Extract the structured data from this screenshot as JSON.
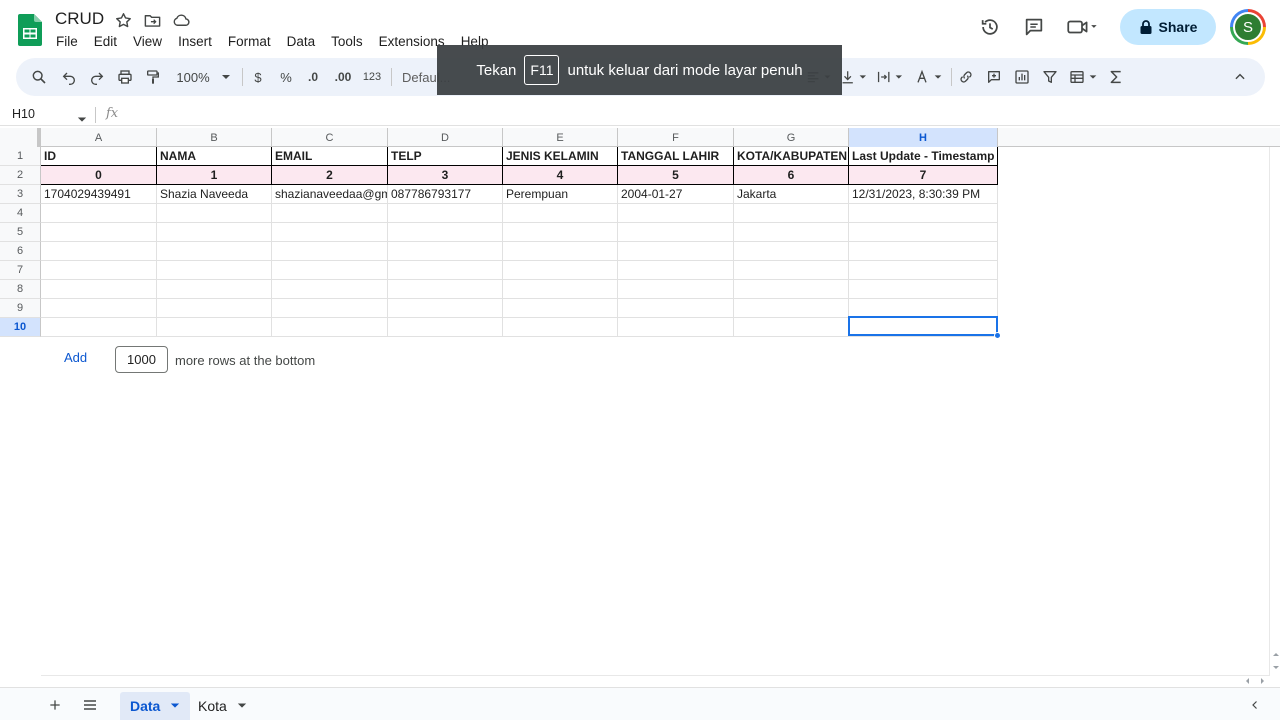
{
  "document": {
    "title": "CRUD"
  },
  "menu": [
    "File",
    "Edit",
    "View",
    "Insert",
    "Format",
    "Data",
    "Tools",
    "Extensions",
    "Help"
  ],
  "header": {
    "share_label": "Share",
    "avatar_letter": "S"
  },
  "toolbar": {
    "zoom": "100%",
    "currency": "$",
    "percent": "%",
    "decrease_decimal": ".0",
    "increase_decimal": ".00",
    "number_format": "123",
    "font": "Defaul..."
  },
  "toast": {
    "prefix": "Tekan",
    "key": "F11",
    "suffix": "untuk keluar dari mode layar penuh"
  },
  "formula_bar": {
    "cell_ref": "H10",
    "fx": "fx"
  },
  "grid": {
    "columns": [
      "A",
      "B",
      "C",
      "D",
      "E",
      "F",
      "G",
      "H"
    ],
    "row_numbers": [
      "1",
      "2",
      "3",
      "4",
      "5",
      "6",
      "7",
      "8",
      "9",
      "10"
    ],
    "rows": [
      [
        "ID",
        "NAMA",
        "EMAIL",
        "TELP",
        "JENIS KELAMIN",
        "TANGGAL LAHIR",
        "KOTA/KABUPATEN",
        "Last Update - Timestamp"
      ],
      [
        "0",
        "1",
        "2",
        "3",
        "4",
        "5",
        "6",
        "7"
      ],
      [
        "1704029439491",
        "Shazia Naveeda",
        "shazianaveedaa@gm",
        "087786793177",
        "Perempuan",
        "2004-01-27",
        "Jakarta",
        "12/31/2023, 8:30:39 PM"
      ]
    ],
    "active_column": "H",
    "active_row": "10"
  },
  "add_rows": {
    "button": "Add",
    "count": "1000",
    "suffix": "more rows at the bottom"
  },
  "sheets": [
    {
      "name": "Data",
      "active": true
    },
    {
      "name": "Kota",
      "active": false
    }
  ]
}
